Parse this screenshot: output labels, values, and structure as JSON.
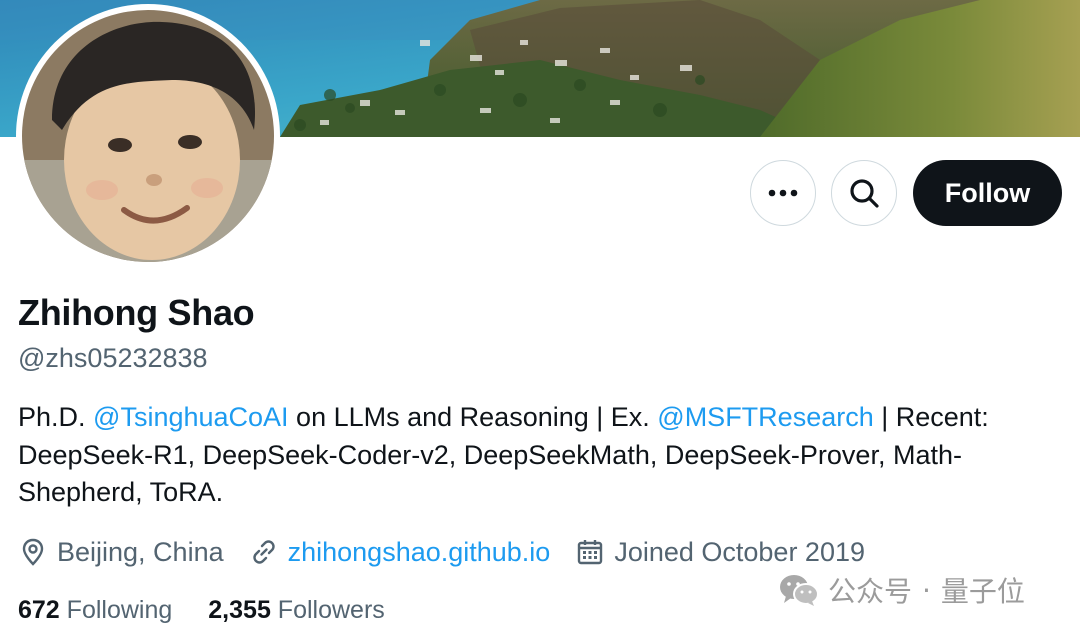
{
  "profile": {
    "name": "Zhihong Shao",
    "handle": "@zhs05232838",
    "bio": {
      "p1": "Ph.D. ",
      "mention1": "@TsinghuaCoAI",
      "p2": " on LLMs and Reasoning | Ex. ",
      "mention2": "@MSFTResearch",
      "p3": " | Recent: DeepSeek-R1, DeepSeek-Coder-v2, DeepSeekMath, DeepSeek-Prover, Math-Shepherd, ToRA."
    },
    "location": "Beijing, China",
    "website": "zhihongshao.github.io",
    "joined": "Joined October 2019",
    "following_count": "672",
    "following_label": "Following",
    "followers_count": "2,355",
    "followers_label": "Followers"
  },
  "actions": {
    "follow_label": "Follow",
    "more_icon": "more-horizontal-icon",
    "search_icon": "search-icon"
  },
  "watermark": {
    "brand": "公众号",
    "sep": "·",
    "name": "量子位"
  },
  "colors": {
    "primary_text": "#0f1419",
    "secondary_text": "#536471",
    "link": "#1d9bf0",
    "follow_bg": "#0f1419"
  }
}
